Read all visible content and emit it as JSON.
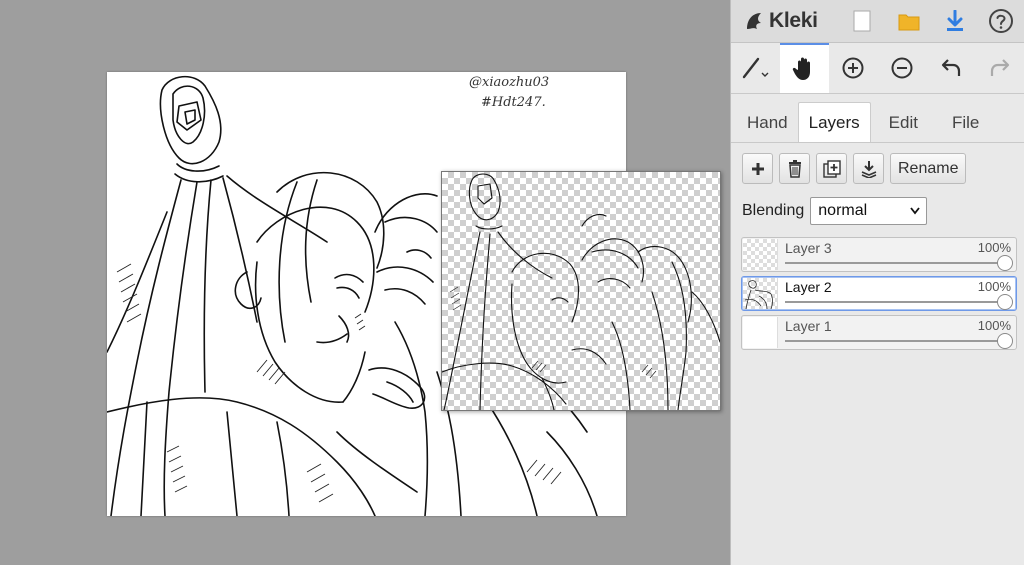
{
  "app": {
    "name": "Kleki"
  },
  "canvas": {
    "watermark_line1": "@xiaozhu03",
    "watermark_line2": "#Hdt247."
  },
  "toolbar": {
    "tools": [
      "brush",
      "hand",
      "zoom-in",
      "zoom-out",
      "undo",
      "redo"
    ],
    "active_tool": "hand"
  },
  "tabs": [
    {
      "label": "Hand"
    },
    {
      "label": "Layers"
    },
    {
      "label": "Edit"
    },
    {
      "label": "File"
    }
  ],
  "active_tab": "Layers",
  "layer_actions": {
    "rename_label": "Rename"
  },
  "blending": {
    "label": "Blending",
    "value": "normal"
  },
  "layers": [
    {
      "name": "Layer 3",
      "opacity": "100%",
      "opacity_value": 1.0
    },
    {
      "name": "Layer 2",
      "opacity": "100%",
      "opacity_value": 1.0,
      "selected": true
    },
    {
      "name": "Layer 1",
      "opacity": "100%",
      "opacity_value": 1.0
    }
  ],
  "colors": {
    "accent": "#5b8ee6",
    "folder": "#f0b429",
    "download": "#2f7de1"
  }
}
